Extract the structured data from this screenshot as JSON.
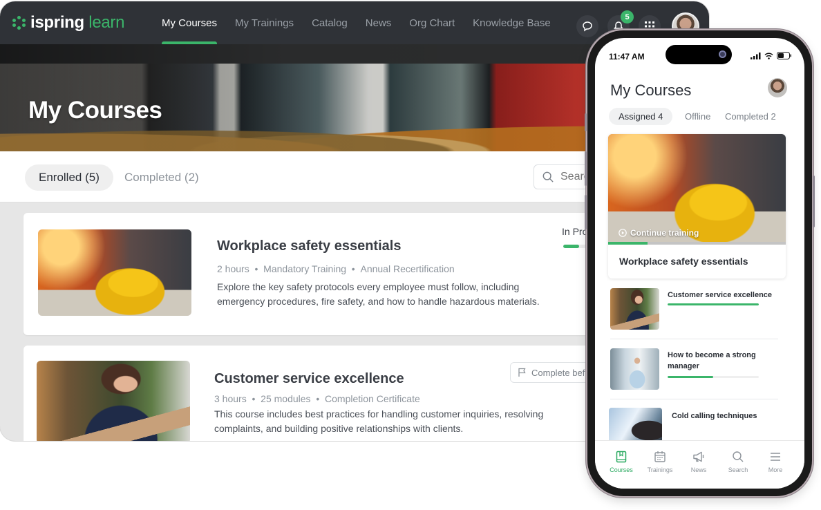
{
  "desktop": {
    "logo": {
      "brand": "ispring",
      "product": "learn"
    },
    "nav": [
      {
        "label": "My Courses",
        "active": true
      },
      {
        "label": "My Trainings",
        "active": false
      },
      {
        "label": "Catalog",
        "active": false
      },
      {
        "label": "News",
        "active": false
      },
      {
        "label": "Org Chart",
        "active": false
      },
      {
        "label": "Knowledge Base",
        "active": false
      }
    ],
    "header_icons": {
      "chat": "chat-bubble-icon",
      "notifications": "bell-icon",
      "notifications_count": "5",
      "apps": "grid-icon",
      "avatar": "user-avatar"
    },
    "hero_title": "My Courses",
    "tabs": [
      {
        "label": "Enrolled (5)",
        "active": true
      },
      {
        "label": "Completed (2)",
        "active": false
      }
    ],
    "search": {
      "placeholder": "Search",
      "icon": "search-icon"
    },
    "courses": [
      {
        "title": "Workplace safety essentials",
        "meta": [
          "2 hours",
          "Mandatory Training",
          "Annual Recertification"
        ],
        "description": "Explore the key safety protocols every employee must follow, including emergency procedures, fire safety, and how to handle hazardous materials.",
        "status": "In Progress",
        "progress": 0.3
      },
      {
        "title": "Customer service excellence",
        "meta": [
          "3 hours",
          "25 modules",
          "Completion Certificate"
        ],
        "description": "This course includes best practices for handling customer inquiries, resolving complaints, and building positive relationships with clients.",
        "deadline_label": "Complete before",
        "deadline_icon": "flag-icon"
      }
    ]
  },
  "phone": {
    "status_time": "11:47 AM",
    "title": "My Courses",
    "tabs": [
      {
        "label": "Assigned 4",
        "active": true
      },
      {
        "label": "Offline",
        "active": false
      },
      {
        "label": "Completed 2",
        "active": false
      }
    ],
    "featured": {
      "continue_label": "Continue training",
      "title": "Workplace safety essentials",
      "progress": 0.22
    },
    "list": [
      {
        "title": "Customer service excellence",
        "progress": 1.0
      },
      {
        "title": "How to become a strong manager",
        "progress": 0.5
      },
      {
        "title": "Cold calling techniques",
        "progress": null
      }
    ],
    "tabbar": [
      {
        "label": "Courses",
        "icon": "book-icon",
        "active": true
      },
      {
        "label": "Trainings",
        "icon": "calendar-icon",
        "active": false
      },
      {
        "label": "News",
        "icon": "megaphone-icon",
        "active": false
      },
      {
        "label": "Search",
        "icon": "search-icon",
        "active": false
      },
      {
        "label": "More",
        "icon": "menu-icon",
        "active": false
      }
    ],
    "colors": {
      "accent": "#3bb56a",
      "header": "#2f3237"
    }
  }
}
